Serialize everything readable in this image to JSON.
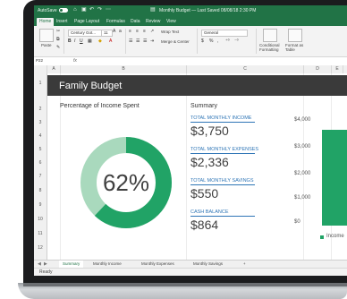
{
  "titlebar": {
    "autosave_label": "AutoSave",
    "autosave_state": "on",
    "title": "Monthly Budget — Last Saved 08/08/18 2:30 PM"
  },
  "tabs": [
    "Home",
    "Insert",
    "Page Layout",
    "Formulas",
    "Data",
    "Review",
    "View"
  ],
  "ribbon": {
    "paste_label": "Paste",
    "font_name": "Century Got...",
    "font_size": "11",
    "wrap_text_label": "Wrap Text",
    "merge_center_label": "Merge & Center",
    "number_format": "General",
    "conditional_formatting_label": "Conditional Formatting",
    "format_as_table_label": "Format as Table"
  },
  "formula_bar": {
    "name_box": "P22",
    "fx_label": "fx"
  },
  "columns": [
    "A",
    "B",
    "C",
    "D",
    "E",
    "F"
  ],
  "rows": [
    "1",
    "2",
    "3",
    "4",
    "5",
    "6",
    "7",
    "8",
    "9",
    "10",
    "11",
    "12"
  ],
  "sheet": {
    "title": "Family Budget",
    "percentage_title": "Percentage of Income Spent",
    "percentage_value": "62%",
    "percentage_fraction": 0.62,
    "summary_title": "Summary",
    "stats": [
      {
        "label": "TOTAL MONTHLY INCOME",
        "value": "$3,750"
      },
      {
        "label": "TOTAL MONTHLY EXPENSES",
        "value": "$2,336"
      },
      {
        "label": "TOTAL MONTHLY SAVINGS",
        "value": "$550"
      },
      {
        "label": "CASH BALANCE",
        "value": "$864"
      }
    ]
  },
  "chart_data": {
    "type": "bar",
    "categories": [
      ""
    ],
    "series": [
      {
        "name": "Income",
        "values": [
          3750
        ]
      }
    ],
    "ytick_labels": [
      "$4,000",
      "$3,000",
      "$2,000",
      "$1,000",
      "$0"
    ],
    "ylim": [
      0,
      4000
    ],
    "legend": "bottom-right",
    "color": "#21a366"
  },
  "sheet_tabs": [
    "Summary",
    "Monthly Income",
    "Monthly Expenses",
    "Monthly Savings"
  ],
  "add_sheet": "+",
  "status": "Ready",
  "colors": {
    "excel_green": "#217346",
    "donut_dark": "#21a366",
    "donut_light": "#a9d9bd",
    "banner": "#3a3a3a",
    "stat_label": "#2e75b6"
  }
}
